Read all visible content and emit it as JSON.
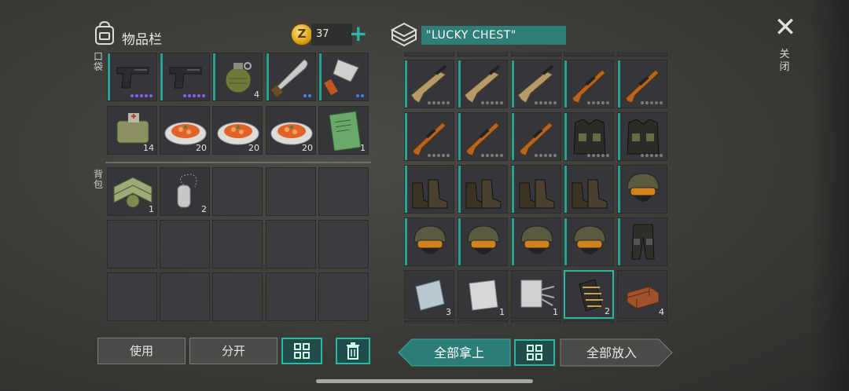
{
  "inventory": {
    "title": "物品栏",
    "coins": "37",
    "coin_symbol": "Z",
    "plus": "+",
    "pocket_label": "口袋",
    "backpack_label": "背包",
    "pocket_row1": [
      {
        "icon": "pistol-icon",
        "qty": "",
        "dots": 5,
        "dot_color": "#8b5cf6"
      },
      {
        "icon": "pistol-icon",
        "qty": "",
        "dots": 5,
        "dot_color": "#8b5cf6"
      },
      {
        "icon": "grenade-icon",
        "qty": "4",
        "dots": 0
      },
      {
        "icon": "machete-icon",
        "qty": "",
        "dots": 2,
        "dot_color": "#3b82f6"
      },
      {
        "icon": "cleaver-icon",
        "qty": "",
        "dots": 2,
        "dot_color": "#3b82f6"
      }
    ],
    "pocket_row2": [
      {
        "icon": "medkit-bag-icon",
        "qty": "14"
      },
      {
        "icon": "food-bowl-icon",
        "qty": "20"
      },
      {
        "icon": "food-bowl-icon",
        "qty": "20"
      },
      {
        "icon": "food-bowl-icon",
        "qty": "20"
      },
      {
        "icon": "notebook-icon",
        "qty": "1"
      }
    ],
    "backpack": [
      {
        "icon": "sergeant-badge-icon",
        "qty": "1"
      },
      {
        "icon": "dog-tag-icon",
        "qty": "2"
      }
    ]
  },
  "chest": {
    "title": "\"LUCKY CHEST\"",
    "rows": [
      [
        {
          "icon": "assault-rifle-icon",
          "qty": ""
        },
        {
          "icon": "assault-rifle-icon",
          "qty": ""
        },
        {
          "icon": "assault-rifle-icon",
          "qty": ""
        },
        {
          "icon": "sniper-rifle-icon",
          "qty": ""
        },
        {
          "icon": "sniper-rifle-icon",
          "qty": ""
        }
      ],
      [
        {
          "icon": "sniper-rifle-icon",
          "qty": ""
        },
        {
          "icon": "sniper-rifle-icon",
          "qty": ""
        },
        {
          "icon": "sniper-rifle-icon",
          "qty": ""
        },
        {
          "icon": "tactical-vest-icon",
          "qty": ""
        },
        {
          "icon": "tactical-vest-icon",
          "qty": ""
        }
      ],
      [
        {
          "icon": "combat-boots-icon",
          "qty": ""
        },
        {
          "icon": "combat-boots-icon",
          "qty": ""
        },
        {
          "icon": "combat-boots-icon",
          "qty": ""
        },
        {
          "icon": "combat-boots-icon",
          "qty": ""
        },
        {
          "icon": "helmet-icon",
          "qty": ""
        }
      ],
      [
        {
          "icon": "helmet-icon",
          "qty": ""
        },
        {
          "icon": "helmet-icon",
          "qty": ""
        },
        {
          "icon": "helmet-icon",
          "qty": ""
        },
        {
          "icon": "helmet-icon",
          "qty": ""
        },
        {
          "icon": "tactical-pants-icon",
          "qty": ""
        }
      ],
      [
        {
          "icon": "metal-plate-icon",
          "qty": "3"
        },
        {
          "icon": "steel-sheet-icon",
          "qty": "1"
        },
        {
          "icon": "wire-mesh-icon",
          "qty": "1"
        },
        {
          "icon": "spring-part-icon",
          "qty": "2"
        },
        {
          "icon": "bricks-icon",
          "qty": "4"
        }
      ]
    ]
  },
  "close": {
    "symbol": "✕",
    "label": "关闭"
  },
  "buttons": {
    "use": "使用",
    "split": "分开",
    "take_all": "全部拿上",
    "put_all": "全部放入"
  }
}
